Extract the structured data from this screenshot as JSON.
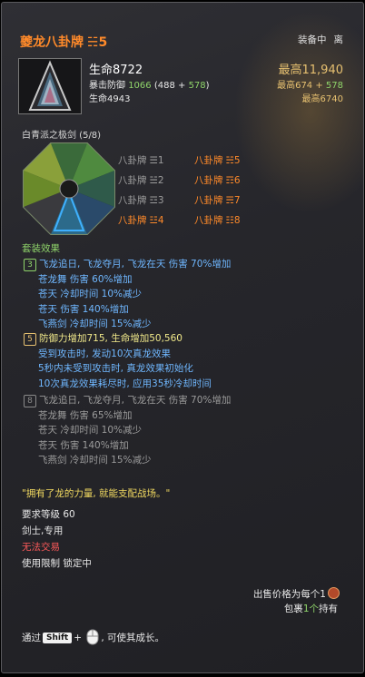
{
  "item": {
    "name": "夔龙八卦牌",
    "trigram": "☵5",
    "status_equipped": "装备中",
    "status_leave": "离",
    "life": "生命8722",
    "crit_def_label": "暴击防御",
    "crit_def_value": "1066",
    "crit_def_breakdown_a": "(488 + ",
    "crit_def_breakdown_b": "578",
    "crit_def_breakdown_c": ")",
    "hp2": "生命4943",
    "max1": "最高11,940",
    "max2_a": "最高674 + ",
    "max2_b": "578",
    "max3": "最高6740"
  },
  "set": {
    "name": "白青派之极剑 (5/8)",
    "slots": [
      {
        "label": "八卦牌",
        "trigram": "☰1",
        "active": false
      },
      {
        "label": "八卦牌",
        "trigram": "☵5",
        "active": true
      },
      {
        "label": "八卦牌",
        "trigram": "☱2",
        "active": false
      },
      {
        "label": "八卦牌",
        "trigram": "☶6",
        "active": true
      },
      {
        "label": "八卦牌",
        "trigram": "☲3",
        "active": false
      },
      {
        "label": "八卦牌",
        "trigram": "☴7",
        "active": true
      },
      {
        "label": "八卦牌",
        "trigram": "☳4",
        "active": true
      },
      {
        "label": "八卦牌",
        "trigram": "☷8",
        "active": true
      }
    ]
  },
  "effects": {
    "title": "套装效果",
    "tier3": {
      "num": "3",
      "lines": [
        "飞龙追日, 飞龙夺月, 飞龙在天 伤害 70%增加",
        "苍龙舞 伤害 60%增加",
        "苍天 冷却时间 10%减少",
        "苍天 伤害 140%增加",
        "飞燕剑 冷却时间 15%减少"
      ]
    },
    "tier5": {
      "num": "5",
      "lines": [
        "防御力增加715, 生命增加50,560",
        "受到攻击时, 发动10次真龙效果",
        "5秒内未受到攻击时, 真龙效果初始化",
        "10次真龙效果耗尽时, 应用35秒冷却时间"
      ]
    },
    "tier8": {
      "num": "8",
      "lines": [
        "飞龙追日, 飞龙夺月, 飞龙在天 伤害 70%增加",
        "苍龙舞 伤害 65%增加",
        "苍天 冷却时间 10%减少",
        "苍天 伤害 140%增加",
        "飞燕剑 冷却时间 15%减少"
      ]
    }
  },
  "quote": "\"拥有了龙的力量, 就能支配战场。\"",
  "requirements": {
    "level": "要求等级 60",
    "class": "剑士,专用",
    "trade": "无法交易",
    "limit": "使用限制 锁定中"
  },
  "price": "出售价格为每个1",
  "bag_a": "包裹",
  "bag_b": "1个",
  "bag_c": "持有",
  "growth": {
    "prefix": "通过",
    "key": "Shift",
    "plus": "+",
    "suffix": ", 可使其成长。"
  },
  "colors": {
    "orange": "#ff8a2a",
    "green": "#8fd46a",
    "blue": "#6fb7ff",
    "gold": "#e6c070"
  }
}
